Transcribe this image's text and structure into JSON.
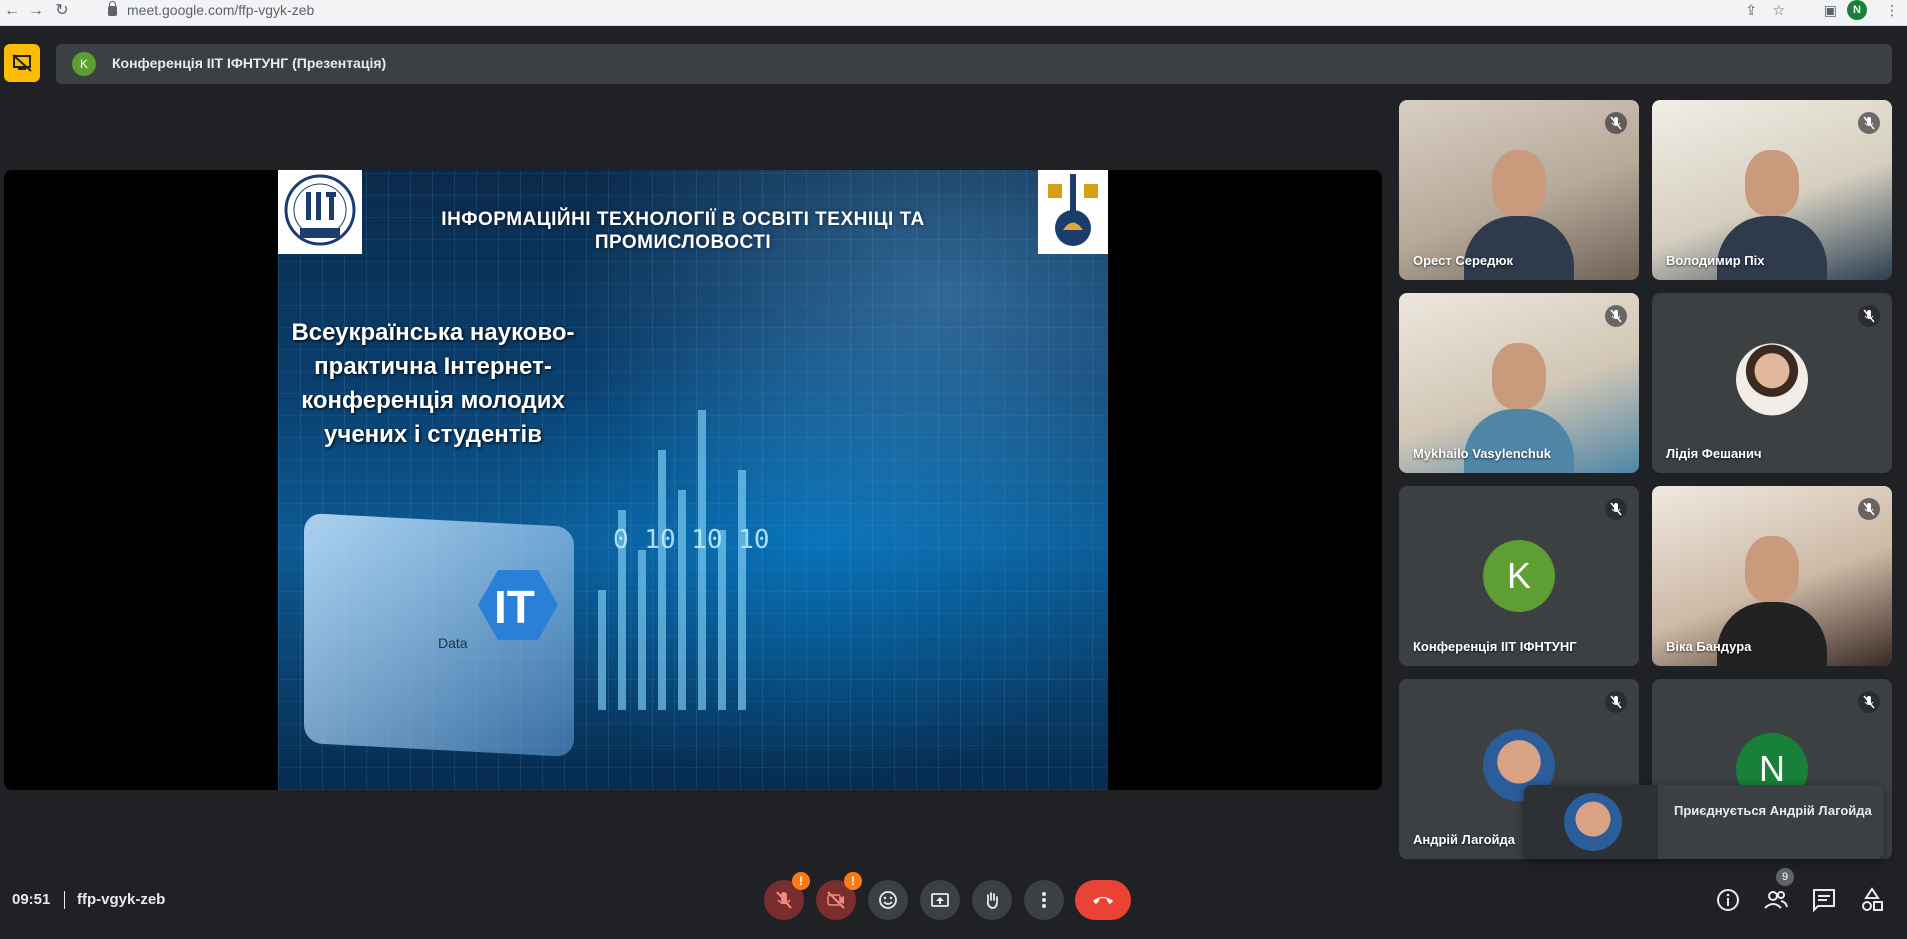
{
  "browser": {
    "url": "meet.google.com/ffp-vgyk-zeb",
    "profile_initial": "N"
  },
  "banner": {
    "avatar_initial": "K",
    "avatar_color": "#5e9e32",
    "title": "Конференція ІІТ ІФНТУНГ (Презентація)"
  },
  "slide": {
    "heading": "ІНФОРМАЦІЙНІ ТЕХНОЛОГІЇ В ОСВІТІ ТЕХНІЦІ ТА ПРОМИСЛОВОСТІ",
    "subtitle": "Всеукраїнська науково-практична Інтернет-конференція молодих учених і студентів",
    "card_letters": "IT",
    "card_label": "Data",
    "binary_text": "0 10 10 10"
  },
  "participants": [
    {
      "name": "Орест Середюк",
      "type": "video"
    },
    {
      "name": "Володимир Піх",
      "type": "video"
    },
    {
      "name": "Mykhailo Vasylenchuk",
      "type": "video"
    },
    {
      "name": "Лідія Фешанич",
      "type": "photo"
    },
    {
      "name": "Конференція ІІТ ІФНТУНГ",
      "type": "letter",
      "initial": "K",
      "color": "#5e9e32"
    },
    {
      "name": "Віка Бандура",
      "type": "video"
    },
    {
      "name": "Андрій Лагойда",
      "type": "photo"
    },
    {
      "name": "",
      "type": "letter",
      "initial": "N",
      "color": "#188038"
    }
  ],
  "toast": {
    "message": "Приєднується Андрій Лагойда"
  },
  "footer": {
    "time": "09:51",
    "meeting_code": "ffp-vgyk-zeb",
    "warn_mark": "!",
    "participants_count": "9"
  },
  "colors": {
    "background": "#202124",
    "tile": "#3c4043",
    "end_call": "#ea4335",
    "presenting": "#fbbc04",
    "warning": "#fa7b17"
  }
}
